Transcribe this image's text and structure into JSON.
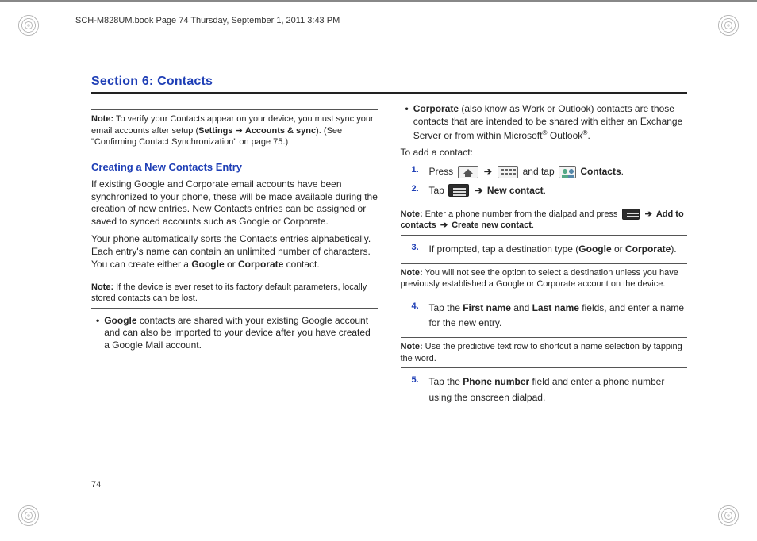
{
  "header_meta": "SCH-M828UM.book  Page 74  Thursday, September 1, 2011  3:43 PM",
  "page_number": "74",
  "section_title": "Section 6: Contacts",
  "left": {
    "note1_label": "Note:",
    "note1_text_a": "To verify your Contacts appear on your device, you must sync your email accounts after setup (",
    "note1_bold1": "Settings",
    "note1_arrow": " ➔ ",
    "note1_bold2": "Accounts & sync",
    "note1_text_b": "). (See \"Confirming Contact Synchronization\" on page 75.)",
    "subhead": "Creating a New Contacts Entry",
    "para1": "If existing Google and Corporate email accounts have been synchronized to your phone, these will be made available during the creation of new entries. New Contacts entries can be assigned or saved to synced accounts such as Google or Corporate.",
    "para2_a": "Your phone automatically sorts the Contacts entries alphabetically. Each entry's name can contain an unlimited number of characters. You can create either a ",
    "para2_b1": "Google",
    "para2_mid": " or ",
    "para2_b2": "Corporate",
    "para2_c": " contact.",
    "note2_label": "Note:",
    "note2_text": "If the device is ever reset to its factory default parameters, locally stored contacts can be lost.",
    "bullet1_b": "Google",
    "bullet1_text": " contacts are shared with your existing Google account and can also be imported to your device after you have created a Google Mail account."
  },
  "right": {
    "bullet2_b": "Corporate",
    "bullet2_text_a": " (also know as Work or Outlook) contacts are those contacts that are intended to be shared with either an Exchange Server or from within Microsoft",
    "bullet2_reg1": "®",
    "bullet2_text_b": " Outlook",
    "bullet2_reg2": "®",
    "bullet2_text_c": ".",
    "toadd": "To add a contact:",
    "step1_press": "Press ",
    "step1_arrow": " ➔ ",
    "step1_andtap": " and tap ",
    "step1_contacts": "Contacts",
    "step1_period": ".",
    "step2_tap": "Tap ",
    "step2_arrow": " ➔ ",
    "step2_newcontact": "New contact",
    "step2_period": ".",
    "note3_label": "Note:",
    "note3_a": "Enter a phone number from the dialpad and press ",
    "note3_arrow1": " ➔ ",
    "note3_b1": "Add to contacts",
    "note3_arrow2": " ➔ ",
    "note3_b2": "Create new contact",
    "note3_period": ".",
    "step3_a": "If prompted, tap a destination type (",
    "step3_b1": "Google",
    "step3_or": " or ",
    "step3_b2": "Corporate",
    "step3_c": ").",
    "note4_label": "Note:",
    "note4_text": "You will not see the option to select a destination unless you have previously established a Google or Corporate account on the device.",
    "step4_a": "Tap the ",
    "step4_b1": "First name",
    "step4_mid": " and ",
    "step4_b2": "Last name",
    "step4_c": " fields, and enter a name for the new entry.",
    "note5_label": "Note:",
    "note5_text": "Use the predictive text row to shortcut a name selection by tapping the word.",
    "step5_a": "Tap the ",
    "step5_b1": "Phone number",
    "step5_c": " field and enter a phone number using the onscreen dialpad."
  }
}
